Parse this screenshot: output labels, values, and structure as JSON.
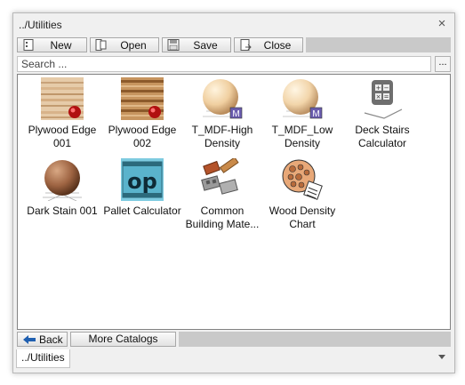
{
  "window": {
    "title": "../Utilities",
    "close_glyph": "×"
  },
  "toolbar": {
    "new_label": "New",
    "open_label": "Open",
    "save_label": "Save",
    "close_label": "Close"
  },
  "search": {
    "placeholder": "Search ...",
    "browse_label": "..."
  },
  "items": [
    {
      "label_1": "Plywood Edge",
      "label_2": "001",
      "icon": "plywood-edge-thumbnail-icon"
    },
    {
      "label_1": "Plywood Edge",
      "label_2": "002",
      "icon": "plywood-edge-thumbnail-icon"
    },
    {
      "label_1": "T_MDF-High",
      "label_2": "Density",
      "icon": "material-sphere-icon"
    },
    {
      "label_1": "T_MDF_Low",
      "label_2": "Density",
      "icon": "material-sphere-icon"
    },
    {
      "label_1": "Deck Stairs",
      "label_2": "Calculator",
      "icon": "calculator-icon"
    },
    {
      "label_1": "Dark Stain 001",
      "label_2": "",
      "icon": "wood-sphere-icon"
    },
    {
      "label_1": "Pallet Calculator",
      "label_2": "",
      "icon": "op-pallet-icon"
    },
    {
      "label_1": "Common",
      "label_2": "Building Mate...",
      "icon": "bricks-icon"
    },
    {
      "label_1": "Wood Density",
      "label_2": "Chart",
      "icon": "wood-chart-icon"
    }
  ],
  "bottom": {
    "back_label": "Back",
    "more_label": "More Catalogs"
  },
  "status": {
    "path": "../Utilities"
  },
  "colors": {
    "accent_blue": "#1f5fb0",
    "window_bg": "#f0f0f0",
    "panel_border": "#828282"
  }
}
